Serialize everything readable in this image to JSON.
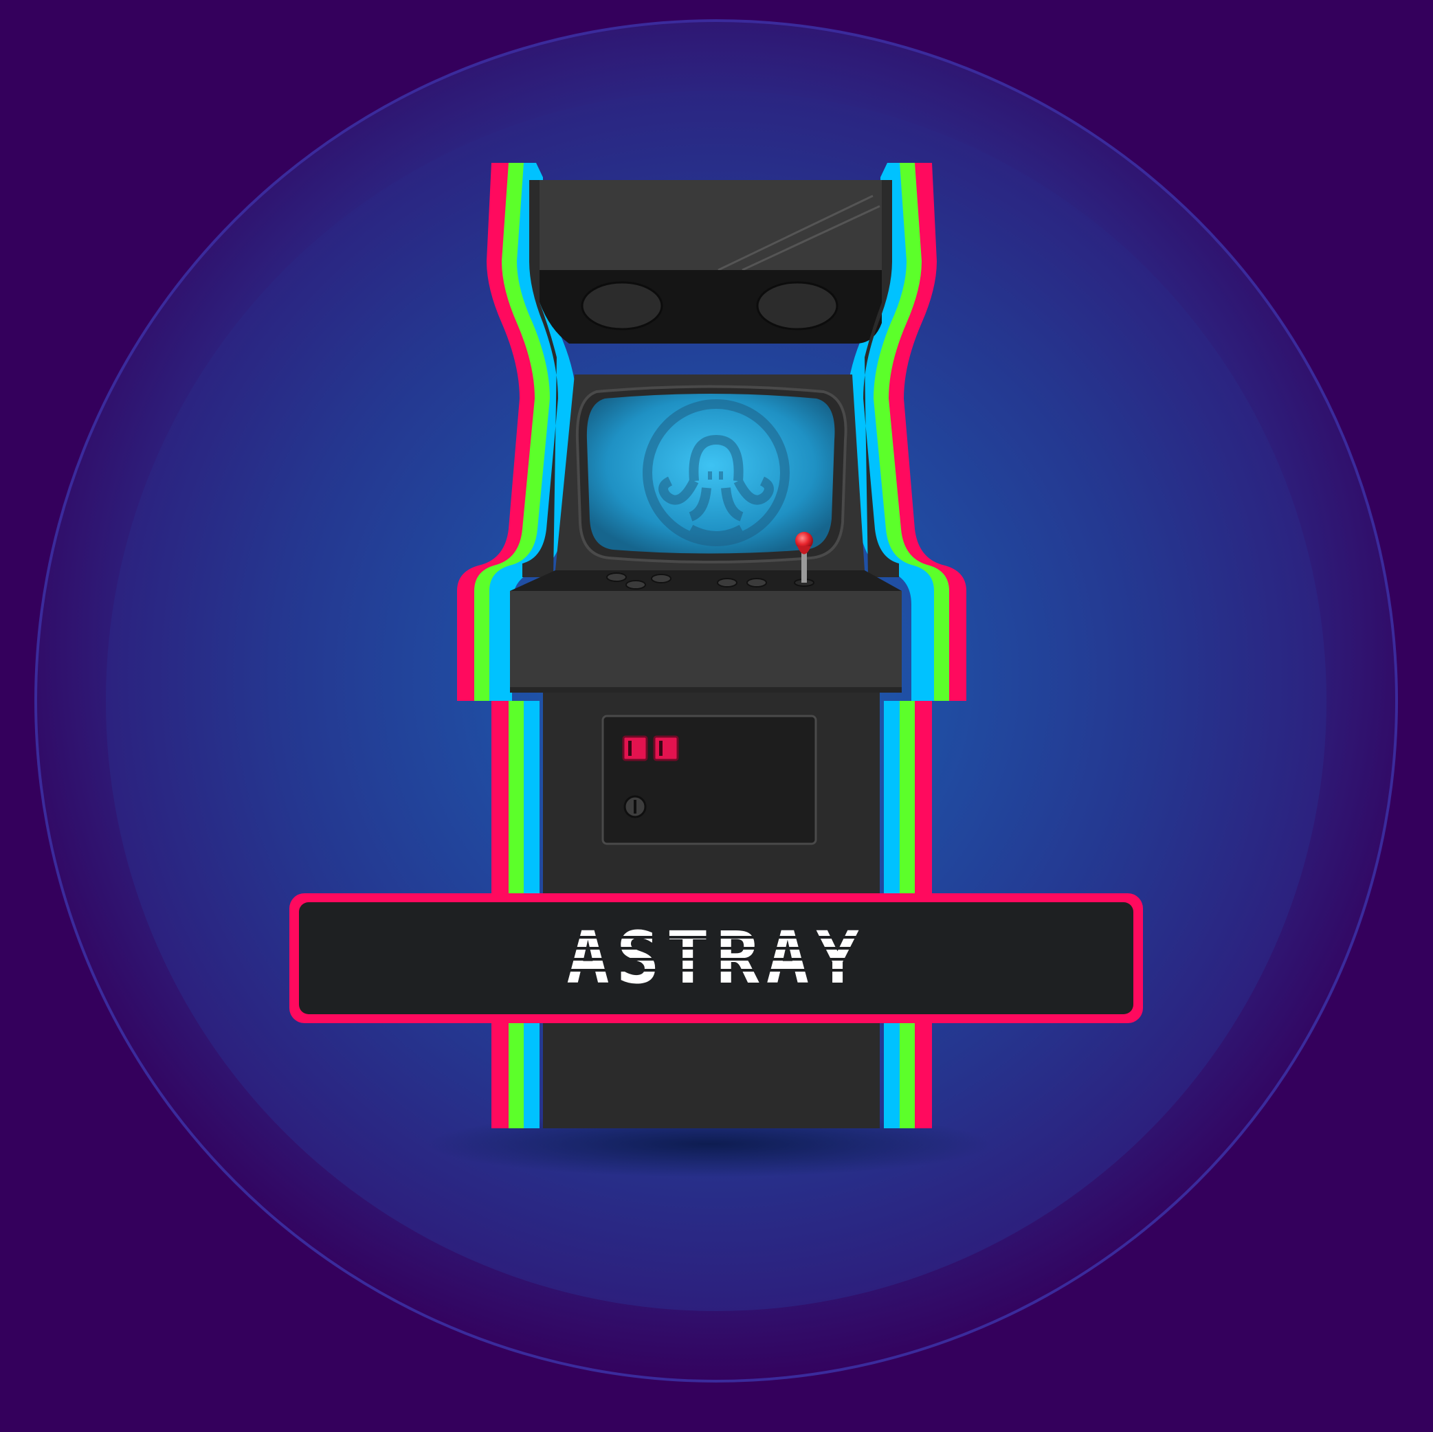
{
  "artwork": {
    "title": "ASTRAY"
  },
  "colors": {
    "background_outer": "#34005c",
    "background_glow": "#1e5aa8",
    "ring": "#3d2fa0",
    "cabinet_dark": "#2b2b2b",
    "cabinet_mid": "#3a3a3a",
    "stripe_pink": "#ff0a5e",
    "stripe_green": "#5cff2a",
    "stripe_blue": "#00c2ff",
    "screen_glow": "#34b6ee",
    "joystick_ball": "#e8242c",
    "coin_slot": "#e3134f"
  },
  "icons": {
    "screen_logo": "octopus-logo-icon",
    "joystick": "joystick-icon",
    "coin_slot": "coin-slot-icon",
    "lock": "keyhole-icon"
  }
}
